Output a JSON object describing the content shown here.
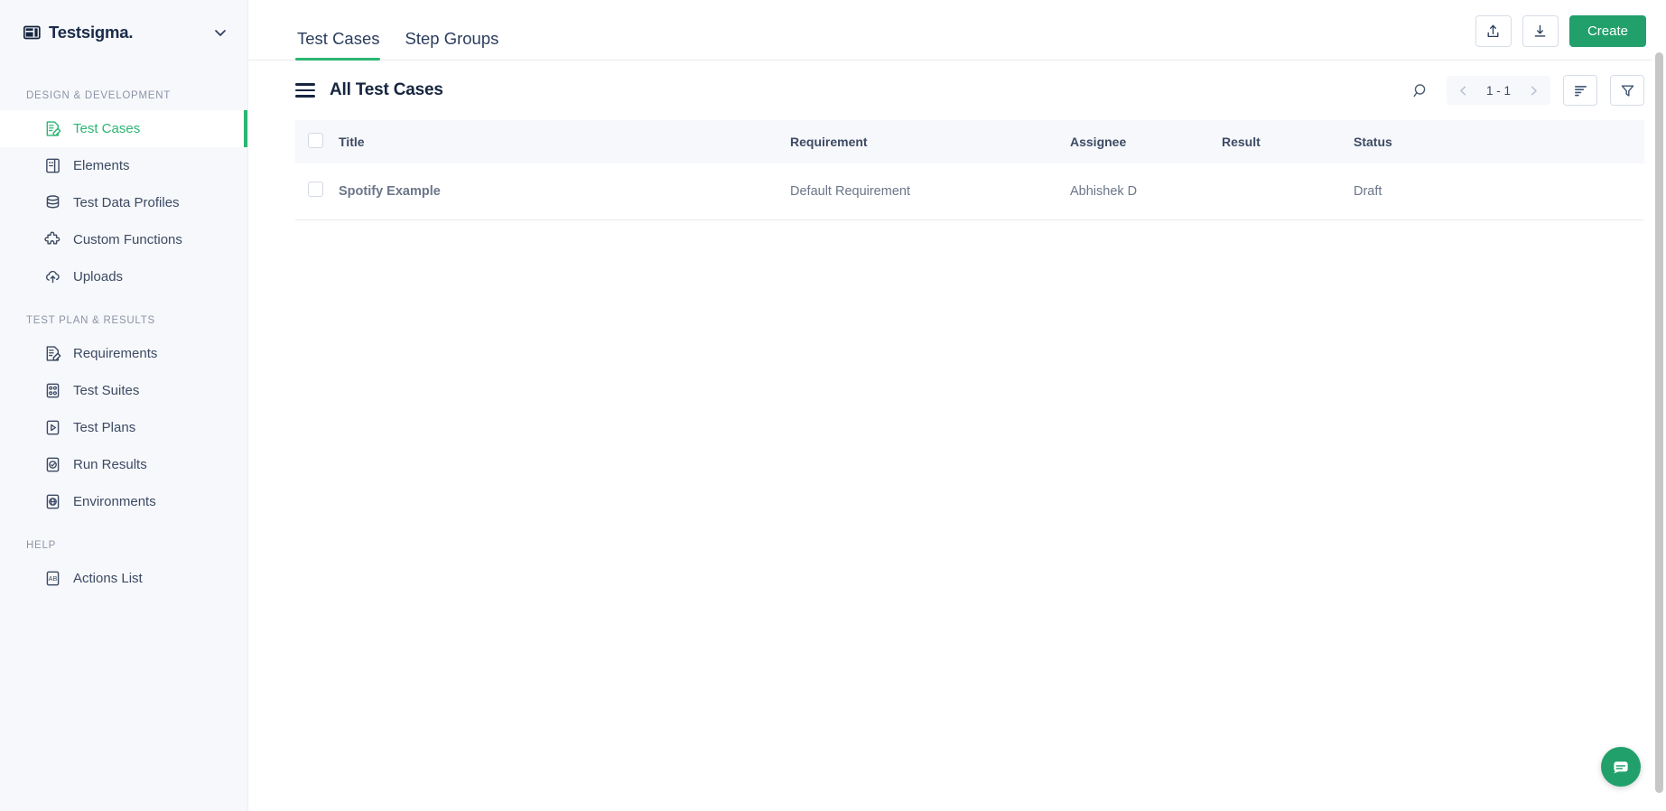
{
  "brand": {
    "name": "Testsigma.",
    "logo_icon": "testsigma-logo-icon",
    "caret_icon": "chevron-down-icon"
  },
  "sidebar": {
    "sections": [
      {
        "title": "DESIGN & DEVELOPMENT",
        "items": [
          {
            "label": "Test Cases",
            "icon": "document-edit-icon",
            "active": true
          },
          {
            "label": "Elements",
            "icon": "elements-panel-icon",
            "active": false
          },
          {
            "label": "Test Data Profiles",
            "icon": "database-icon",
            "active": false
          },
          {
            "label": "Custom Functions",
            "icon": "puzzle-piece-icon",
            "active": false
          },
          {
            "label": "Uploads",
            "icon": "cloud-upload-icon",
            "active": false
          }
        ]
      },
      {
        "title": "TEST PLAN & RESULTS",
        "items": [
          {
            "label": "Requirements",
            "icon": "document-edit-icon",
            "active": false
          },
          {
            "label": "Test Suites",
            "icon": "grid-dots-box-icon",
            "active": false
          },
          {
            "label": "Test Plans",
            "icon": "play-box-icon",
            "active": false
          },
          {
            "label": "Run Results",
            "icon": "check-circle-box-icon",
            "active": false
          },
          {
            "label": "Environments",
            "icon": "globe-box-icon",
            "active": false
          }
        ]
      },
      {
        "title": "HELP",
        "items": [
          {
            "label": "Actions List",
            "icon": "actions-list-icon",
            "active": false
          }
        ]
      }
    ]
  },
  "topbar": {
    "tabs": [
      {
        "label": "Test Cases",
        "active": true
      },
      {
        "label": "Step Groups",
        "active": false
      }
    ],
    "upload_icon": "upload-icon",
    "download_icon": "download-icon",
    "create_label": "Create"
  },
  "list_header": {
    "menu_icon": "hamburger-menu-icon",
    "title": "All Test Cases",
    "search_icon": "search-icon",
    "pagination": {
      "prev_icon": "chevron-left-icon",
      "range": "1 - 1",
      "next_icon": "chevron-right-icon"
    },
    "sort_icon": "sort-icon",
    "filter_icon": "filter-funnel-icon"
  },
  "table": {
    "columns": [
      "Title",
      "Requirement",
      "Assignee",
      "Result",
      "Status"
    ],
    "rows": [
      {
        "title": "Spotify Example",
        "requirement": "Default Requirement",
        "assignee": "Abhishek D",
        "result": "",
        "status": "Draft"
      }
    ]
  },
  "chat": {
    "icon": "chat-bubble-icon"
  },
  "colors": {
    "accent_green": "#22a06b",
    "active_green": "#2bb673",
    "sidebar_bg": "#f7f8fb",
    "text_dark": "#16253f",
    "text_muted": "#6b7689"
  }
}
